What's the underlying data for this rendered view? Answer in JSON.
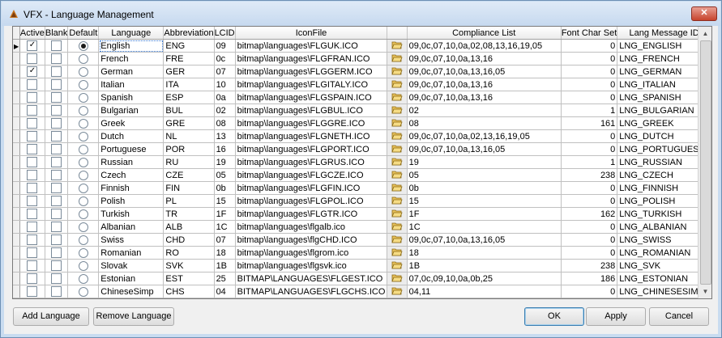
{
  "window": {
    "title": "VFX - Language Management",
    "close_label": "✕"
  },
  "columns": [
    "Active",
    "Blank",
    "Default",
    "Language",
    "Abbreviation",
    "LCID",
    "IconFile",
    "",
    "Compliance List",
    "Font Char Set",
    "Lang Message ID"
  ],
  "rows": [
    {
      "active": true,
      "blank": false,
      "default": true,
      "language": "English",
      "abbr": "ENG",
      "lcid": "09",
      "icon": "bitmap\\languages\\FLGUK.ICO",
      "compliance": "09,0c,07,10,0a,02,08,13,16,19,05",
      "charset": "0",
      "msg": "LNG_ENGLISH"
    },
    {
      "active": false,
      "blank": false,
      "default": false,
      "language": "French",
      "abbr": "FRE",
      "lcid": "0c",
      "icon": "bitmap\\languages\\FLGFRAN.ICO",
      "compliance": "09,0c,07,10,0a,13,16",
      "charset": "0",
      "msg": "LNG_FRENCH"
    },
    {
      "active": true,
      "blank": false,
      "default": false,
      "language": "German",
      "abbr": "GER",
      "lcid": "07",
      "icon": "bitmap\\languages\\FLGGERM.ICO",
      "compliance": "09,0c,07,10,0a,13,16,05",
      "charset": "0",
      "msg": "LNG_GERMAN"
    },
    {
      "active": false,
      "blank": false,
      "default": false,
      "language": "Italian",
      "abbr": "ITA",
      "lcid": "10",
      "icon": "bitmap\\languages\\FLGITALY.ICO",
      "compliance": "09,0c,07,10,0a,13,16",
      "charset": "0",
      "msg": "LNG_ITALIAN"
    },
    {
      "active": false,
      "blank": false,
      "default": false,
      "language": "Spanish",
      "abbr": "ESP",
      "lcid": "0a",
      "icon": "bitmap\\languages\\FLGSPAIN.ICO",
      "compliance": "09,0c,07,10,0a,13,16",
      "charset": "0",
      "msg": "LNG_SPANISH"
    },
    {
      "active": false,
      "blank": false,
      "default": false,
      "language": "Bulgarian",
      "abbr": "BUL",
      "lcid": "02",
      "icon": "bitmap\\languages\\FLGBUL.ICO",
      "compliance": "02",
      "charset": "1",
      "msg": "LNG_BULGARIAN"
    },
    {
      "active": false,
      "blank": false,
      "default": false,
      "language": "Greek",
      "abbr": "GRE",
      "lcid": "08",
      "icon": "bitmap\\languages\\FLGGRE.ICO",
      "compliance": "08",
      "charset": "161",
      "msg": "LNG_GREEK"
    },
    {
      "active": false,
      "blank": false,
      "default": false,
      "language": "Dutch",
      "abbr": "NL",
      "lcid": "13",
      "icon": "bitmap\\languages\\FLGNETH.ICO",
      "compliance": "09,0c,07,10,0a,02,13,16,19,05",
      "charset": "0",
      "msg": "LNG_DUTCH"
    },
    {
      "active": false,
      "blank": false,
      "default": false,
      "language": "Portuguese",
      "abbr": "POR",
      "lcid": "16",
      "icon": "bitmap\\languages\\FLGPORT.ICO",
      "compliance": "09,0c,07,10,0a,13,16,05",
      "charset": "0",
      "msg": "LNG_PORTUGUESE"
    },
    {
      "active": false,
      "blank": false,
      "default": false,
      "language": "Russian",
      "abbr": "RU",
      "lcid": "19",
      "icon": "bitmap\\languages\\FLGRUS.ICO",
      "compliance": "19",
      "charset": "1",
      "msg": "LNG_RUSSIAN"
    },
    {
      "active": false,
      "blank": false,
      "default": false,
      "language": "Czech",
      "abbr": "CZE",
      "lcid": "05",
      "icon": "bitmap\\languages\\FLGCZE.ICO",
      "compliance": "05",
      "charset": "238",
      "msg": "LNG_CZECH"
    },
    {
      "active": false,
      "blank": false,
      "default": false,
      "language": "Finnish",
      "abbr": "FIN",
      "lcid": "0b",
      "icon": "bitmap\\languages\\FLGFIN.ICO",
      "compliance": "0b",
      "charset": "0",
      "msg": "LNG_FINNISH"
    },
    {
      "active": false,
      "blank": false,
      "default": false,
      "language": "Polish",
      "abbr": "PL",
      "lcid": "15",
      "icon": "bitmap\\languages\\FLGPOL.ICO",
      "compliance": "15",
      "charset": "0",
      "msg": "LNG_POLISH"
    },
    {
      "active": false,
      "blank": false,
      "default": false,
      "language": "Turkish",
      "abbr": "TR",
      "lcid": "1F",
      "icon": "bitmap\\languages\\FLGTR.ICO",
      "compliance": "1F",
      "charset": "162",
      "msg": "LNG_TURKISH"
    },
    {
      "active": false,
      "blank": false,
      "default": false,
      "language": "Albanian",
      "abbr": "ALB",
      "lcid": "1C",
      "icon": "bitmap\\languages\\flgalb.ico",
      "compliance": "1C",
      "charset": "0",
      "msg": "LNG_ALBANIAN"
    },
    {
      "active": false,
      "blank": false,
      "default": false,
      "language": "Swiss",
      "abbr": "CHD",
      "lcid": "07",
      "icon": "bitmap\\languages\\flgCHD.ICO",
      "compliance": "09,0c,07,10,0a,13,16,05",
      "charset": "0",
      "msg": "LNG_SWISS"
    },
    {
      "active": false,
      "blank": false,
      "default": false,
      "language": "Romanian",
      "abbr": "RO",
      "lcid": "18",
      "icon": "bitmap\\languages\\flgrom.ico",
      "compliance": "18",
      "charset": "0",
      "msg": "LNG_ROMANIAN"
    },
    {
      "active": false,
      "blank": false,
      "default": false,
      "language": "Slovak",
      "abbr": "SVK",
      "lcid": "1B",
      "icon": "bitmap\\languages\\flgsvk.ico",
      "compliance": "1B",
      "charset": "238",
      "msg": "LNG_SVK"
    },
    {
      "active": false,
      "blank": false,
      "default": false,
      "language": "Estonian",
      "abbr": "EST",
      "lcid": "25",
      "icon": "BITMAP\\LANGUAGES\\FLGEST.ICO",
      "compliance": "07,0c,09,10,0a,0b,25",
      "charset": "186",
      "msg": "LNG_ESTONIAN"
    },
    {
      "active": false,
      "blank": false,
      "default": false,
      "language": "ChineseSimp",
      "abbr": "CHS",
      "lcid": "04",
      "icon": "BITMAP\\LANGUAGES\\FLGCHS.ICO",
      "compliance": "04,11",
      "charset": "0",
      "msg": "LNG_CHINESESIMPL"
    }
  ],
  "buttons": {
    "add_language": "Add Language",
    "remove_language": "Remove Language",
    "ok": "OK",
    "apply": "Apply",
    "cancel": "Cancel"
  },
  "icons": {
    "folder": "open-folder-icon",
    "check": "✓"
  }
}
